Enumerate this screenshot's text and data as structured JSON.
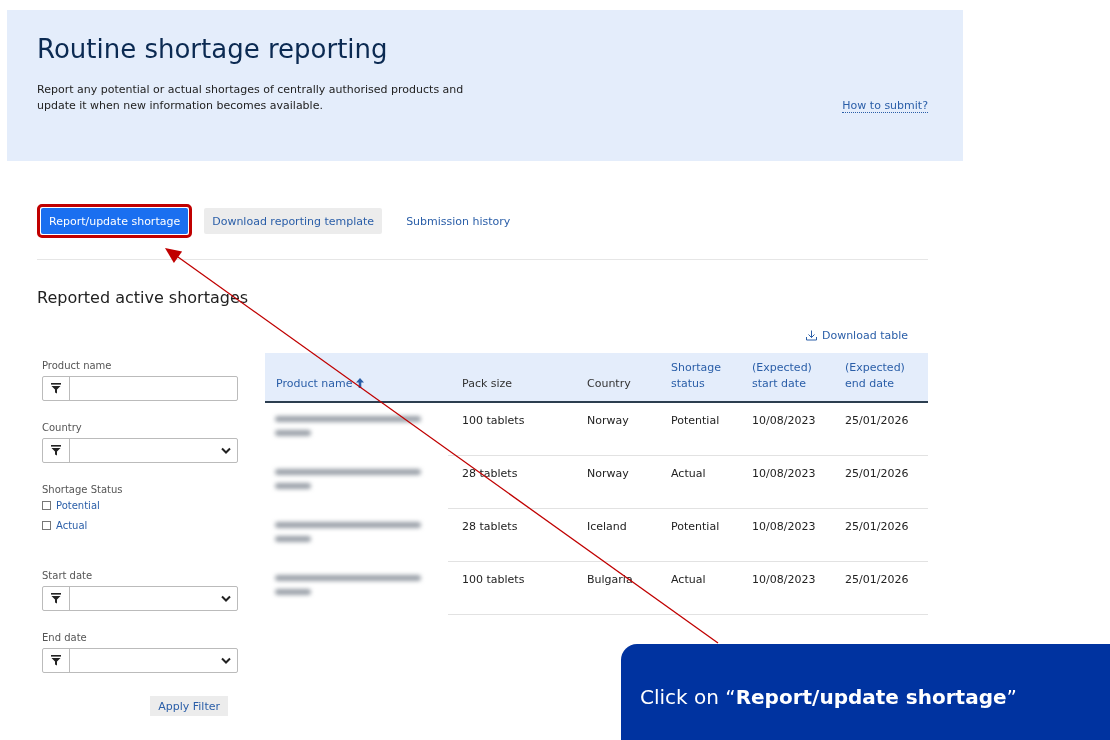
{
  "banner": {
    "title": "Routine shortage reporting",
    "description": "Report any potential or actual shortages of centrally authorised products and update it when new information becomes available.",
    "help_link": "How to submit?"
  },
  "actions": [
    {
      "label": "Report/update shortage",
      "kind": "primary",
      "highlighted": true
    },
    {
      "label": "Download reporting template",
      "kind": "secondary",
      "highlighted": false
    },
    {
      "label": "Submission history",
      "kind": "link",
      "highlighted": false
    }
  ],
  "section_title": "Reported active shortages",
  "download_link": "Download table",
  "filters": [
    {
      "kind": "text",
      "label": "Product name"
    },
    {
      "kind": "select",
      "label": "Country"
    },
    {
      "kind": "checkboxes",
      "label": "Shortage Status",
      "options": [
        {
          "label": "Potential",
          "checked": false
        },
        {
          "label": "Actual",
          "checked": false
        }
      ]
    },
    {
      "kind": "select",
      "label": "Start date"
    },
    {
      "kind": "select",
      "label": "End date"
    }
  ],
  "apply_button": "Apply Filter",
  "table": {
    "columns": [
      {
        "label": "Product name",
        "sortable": true,
        "sorted": true
      },
      {
        "label": "Pack size",
        "sortable": false,
        "sorted": false
      },
      {
        "label": "Country",
        "sortable": false,
        "sorted": false
      },
      {
        "label": "Shortage status",
        "sortable": true,
        "sorted": false
      },
      {
        "label": "(Expected) start date",
        "sortable": true,
        "sorted": false
      },
      {
        "label": "(Expected) end date",
        "sortable": true,
        "sorted": false
      }
    ],
    "rows": [
      {
        "product_blurred": true,
        "cells": [
          "",
          "100 tablets",
          "Norway",
          "Potential",
          "10/08/2023",
          "25/01/2026"
        ]
      },
      {
        "product_blurred": true,
        "cells": [
          "",
          "28 tablets",
          "Norway",
          "Actual",
          "10/08/2023",
          "25/01/2026"
        ]
      },
      {
        "product_blurred": true,
        "cells": [
          "",
          "28 tablets",
          "Iceland",
          "Potential",
          "10/08/2023",
          "25/01/2026"
        ]
      },
      {
        "product_blurred": true,
        "cells": [
          "",
          "100 tablets",
          "Bulgaria",
          "Actual",
          "10/08/2023",
          "25/01/2026"
        ]
      }
    ]
  },
  "callout": {
    "text": "Click on “**Report/update shortage**”"
  }
}
